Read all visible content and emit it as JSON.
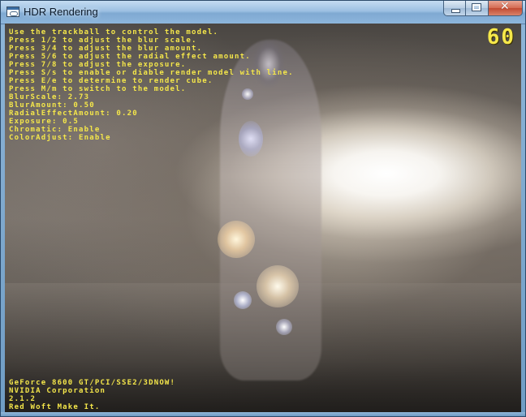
{
  "window": {
    "title": "HDR Rendering"
  },
  "titlebar_controls": {
    "minimize_icon": "minimize-icon",
    "maximize_icon": "maximize-icon",
    "close_glyph": "✕"
  },
  "hud": {
    "fps": "60",
    "lines": [
      "Use the trackball to control the model.",
      "Press 1/2 to adjust the blur scale.",
      "Press 3/4 to adjust the blur amount.",
      "Press 5/6 to adjust the radial effect amount.",
      "Press 7/8 to adjust the exposure.",
      "Press S/s to enable or diable render model with line.",
      "Press E/e to determine to render cube.",
      "Press M/m to switch to the model.",
      "BlurScale: 2.73",
      "BlurAmount: 0.50",
      "RadialEffectAmount: 0.20",
      "Exposure: 0.5",
      "Chromatic: Enable",
      "ColorAdjust: Enable"
    ],
    "renderer_info": [
      "GeForce 8600 GT/PCI/SSE2/3DNOW!",
      "NVIDIA Corporation",
      "2.1.2",
      "Red Woft Make It."
    ]
  },
  "colors": {
    "hud_text": "#f4e64a",
    "titlebar": "#9cc0e2",
    "close_button": "#c24a32"
  }
}
